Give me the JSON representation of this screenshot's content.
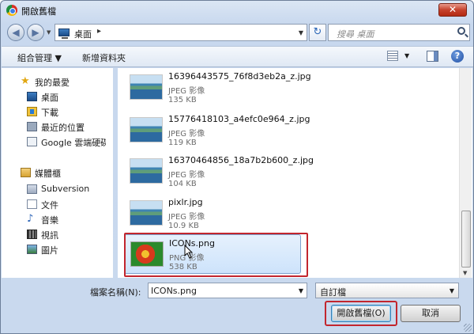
{
  "window": {
    "title": "開啟舊檔",
    "close_label": "✕"
  },
  "address": {
    "path": "桌面",
    "search_placeholder": "搜尋 桌面"
  },
  "toolbar": {
    "organize": "組合管理 ▼",
    "new_folder": "新增資料夾",
    "help": "?"
  },
  "sidebar": {
    "favorites": "我的最愛",
    "items": [
      {
        "label": "桌面",
        "icon": "desktop-icon"
      },
      {
        "label": "下載",
        "icon": "downloads-icon"
      },
      {
        "label": "最近的位置",
        "icon": "recent-places-icon"
      },
      {
        "label": "Google 雲端硬碟",
        "icon": "google-drive-icon"
      }
    ],
    "libraries": "媒體櫃",
    "lib_items": [
      {
        "label": "Subversion",
        "icon": "subversion-icon"
      },
      {
        "label": "文件",
        "icon": "documents-icon"
      },
      {
        "label": "音樂",
        "icon": "music-icon"
      },
      {
        "label": "視訊",
        "icon": "video-icon"
      },
      {
        "label": "圖片",
        "icon": "pictures-icon"
      }
    ]
  },
  "files": [
    {
      "name": "16396443575_76f8d3eb2a_z.jpg",
      "type": "JPEG 影像",
      "size": "135 KB"
    },
    {
      "name": "15776418103_a4efc0e964_z.jpg",
      "type": "JPEG 影像",
      "size": "119 KB"
    },
    {
      "name": "16370464856_18a7b2b600_z.jpg",
      "type": "JPEG 影像",
      "size": "104 KB"
    },
    {
      "name": "pixlr.jpg",
      "type": "JPEG 影像",
      "size": "10.9 KB"
    },
    {
      "name": "ICONs.png",
      "type": "PNG 影像",
      "size": "538 KB"
    }
  ],
  "footer": {
    "filename_label": "檔案名稱(N):",
    "filename_value": "ICONs.png",
    "filter_value": "自訂檔",
    "open_button": "開啟舊檔(O)",
    "cancel_button": "取消"
  },
  "colors": {
    "highlight": "#c2262e",
    "selection": "#cde3fb"
  }
}
